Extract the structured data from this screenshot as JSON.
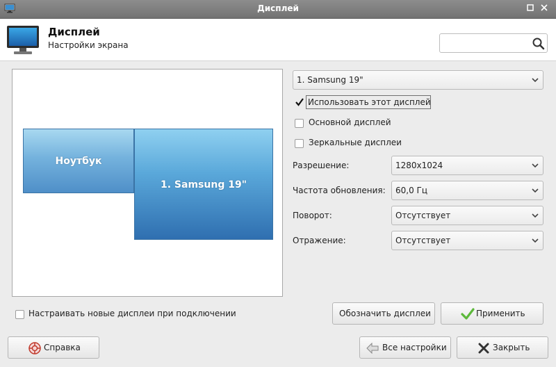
{
  "window": {
    "title": "Дисплей"
  },
  "header": {
    "title": "Дисплей",
    "subtitle": "Настройки экрана"
  },
  "search": {
    "value": "",
    "placeholder": ""
  },
  "layout": {
    "screens": [
      {
        "label": "Ноутбук"
      },
      {
        "label": "1. Samsung 19\""
      }
    ]
  },
  "display_select": {
    "value": "1. Samsung 19\""
  },
  "options": {
    "use_display": {
      "label": "Использовать этот дисплей",
      "checked": true
    },
    "primary_display": {
      "label": "Основной дисплей",
      "checked": false
    },
    "mirror_displays": {
      "label": "Зеркальные дисплеи",
      "checked": false
    }
  },
  "settings": {
    "resolution": {
      "label": "Разрешение:",
      "value": "1280x1024"
    },
    "refresh_rate": {
      "label": "Частота обновления:",
      "value": "60,0 Гц"
    },
    "rotation": {
      "label": "Поворот:",
      "value": "Отсутствует"
    },
    "reflection": {
      "label": "Отражение:",
      "value": "Отсутствует"
    }
  },
  "configure_new": {
    "label": "Настраивать новые дисплеи при подключении",
    "checked": false
  },
  "buttons": {
    "identify": "Обозначить дисплеи",
    "apply": "Применить",
    "help": "Справка",
    "all_settings": "Все настройки",
    "close": "Закрыть"
  },
  "colors": {
    "accent_blue": "#3a8fd0",
    "apply_check_green": "#5cb83a",
    "close_x_dark": "#333333"
  },
  "icons": {
    "app": "monitor-icon",
    "search": "search-icon",
    "help": "help-icon",
    "all_settings": "back-arrow-icon",
    "apply": "checkmark-icon",
    "close": "close-x-icon"
  }
}
